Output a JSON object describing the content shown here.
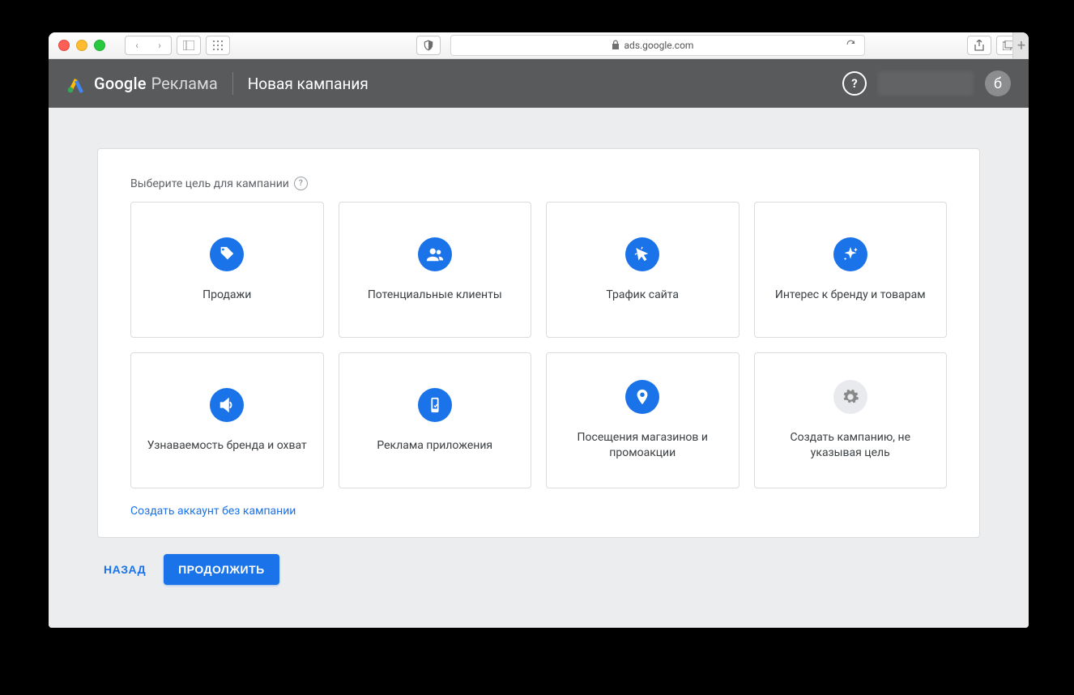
{
  "browser": {
    "url_domain": "ads.google.com"
  },
  "header": {
    "product_google": "Google",
    "product_ads": "Реклама",
    "page_title": "Новая кампания",
    "avatar_letter": "б"
  },
  "section": {
    "title": "Выберите цель для кампании"
  },
  "goals": [
    {
      "icon": "tag",
      "label": "Продажи"
    },
    {
      "icon": "people",
      "label": "Потенциальные клиенты"
    },
    {
      "icon": "cursor",
      "label": "Трафик сайта"
    },
    {
      "icon": "sparkle",
      "label": "Интерес к бренду и товарам"
    },
    {
      "icon": "speaker",
      "label": "Узнаваемость бренда и охват"
    },
    {
      "icon": "phone",
      "label": "Реклама приложения"
    },
    {
      "icon": "pin",
      "label": "Посещения магазинов и промоакции"
    },
    {
      "icon": "gear",
      "label": "Создать кампанию, не указывая цель",
      "grey": true
    }
  ],
  "links": {
    "create_without_campaign": "Создать аккаунт без кампании"
  },
  "buttons": {
    "back": "НАЗАД",
    "continue": "ПРОДОЛЖИТЬ"
  }
}
